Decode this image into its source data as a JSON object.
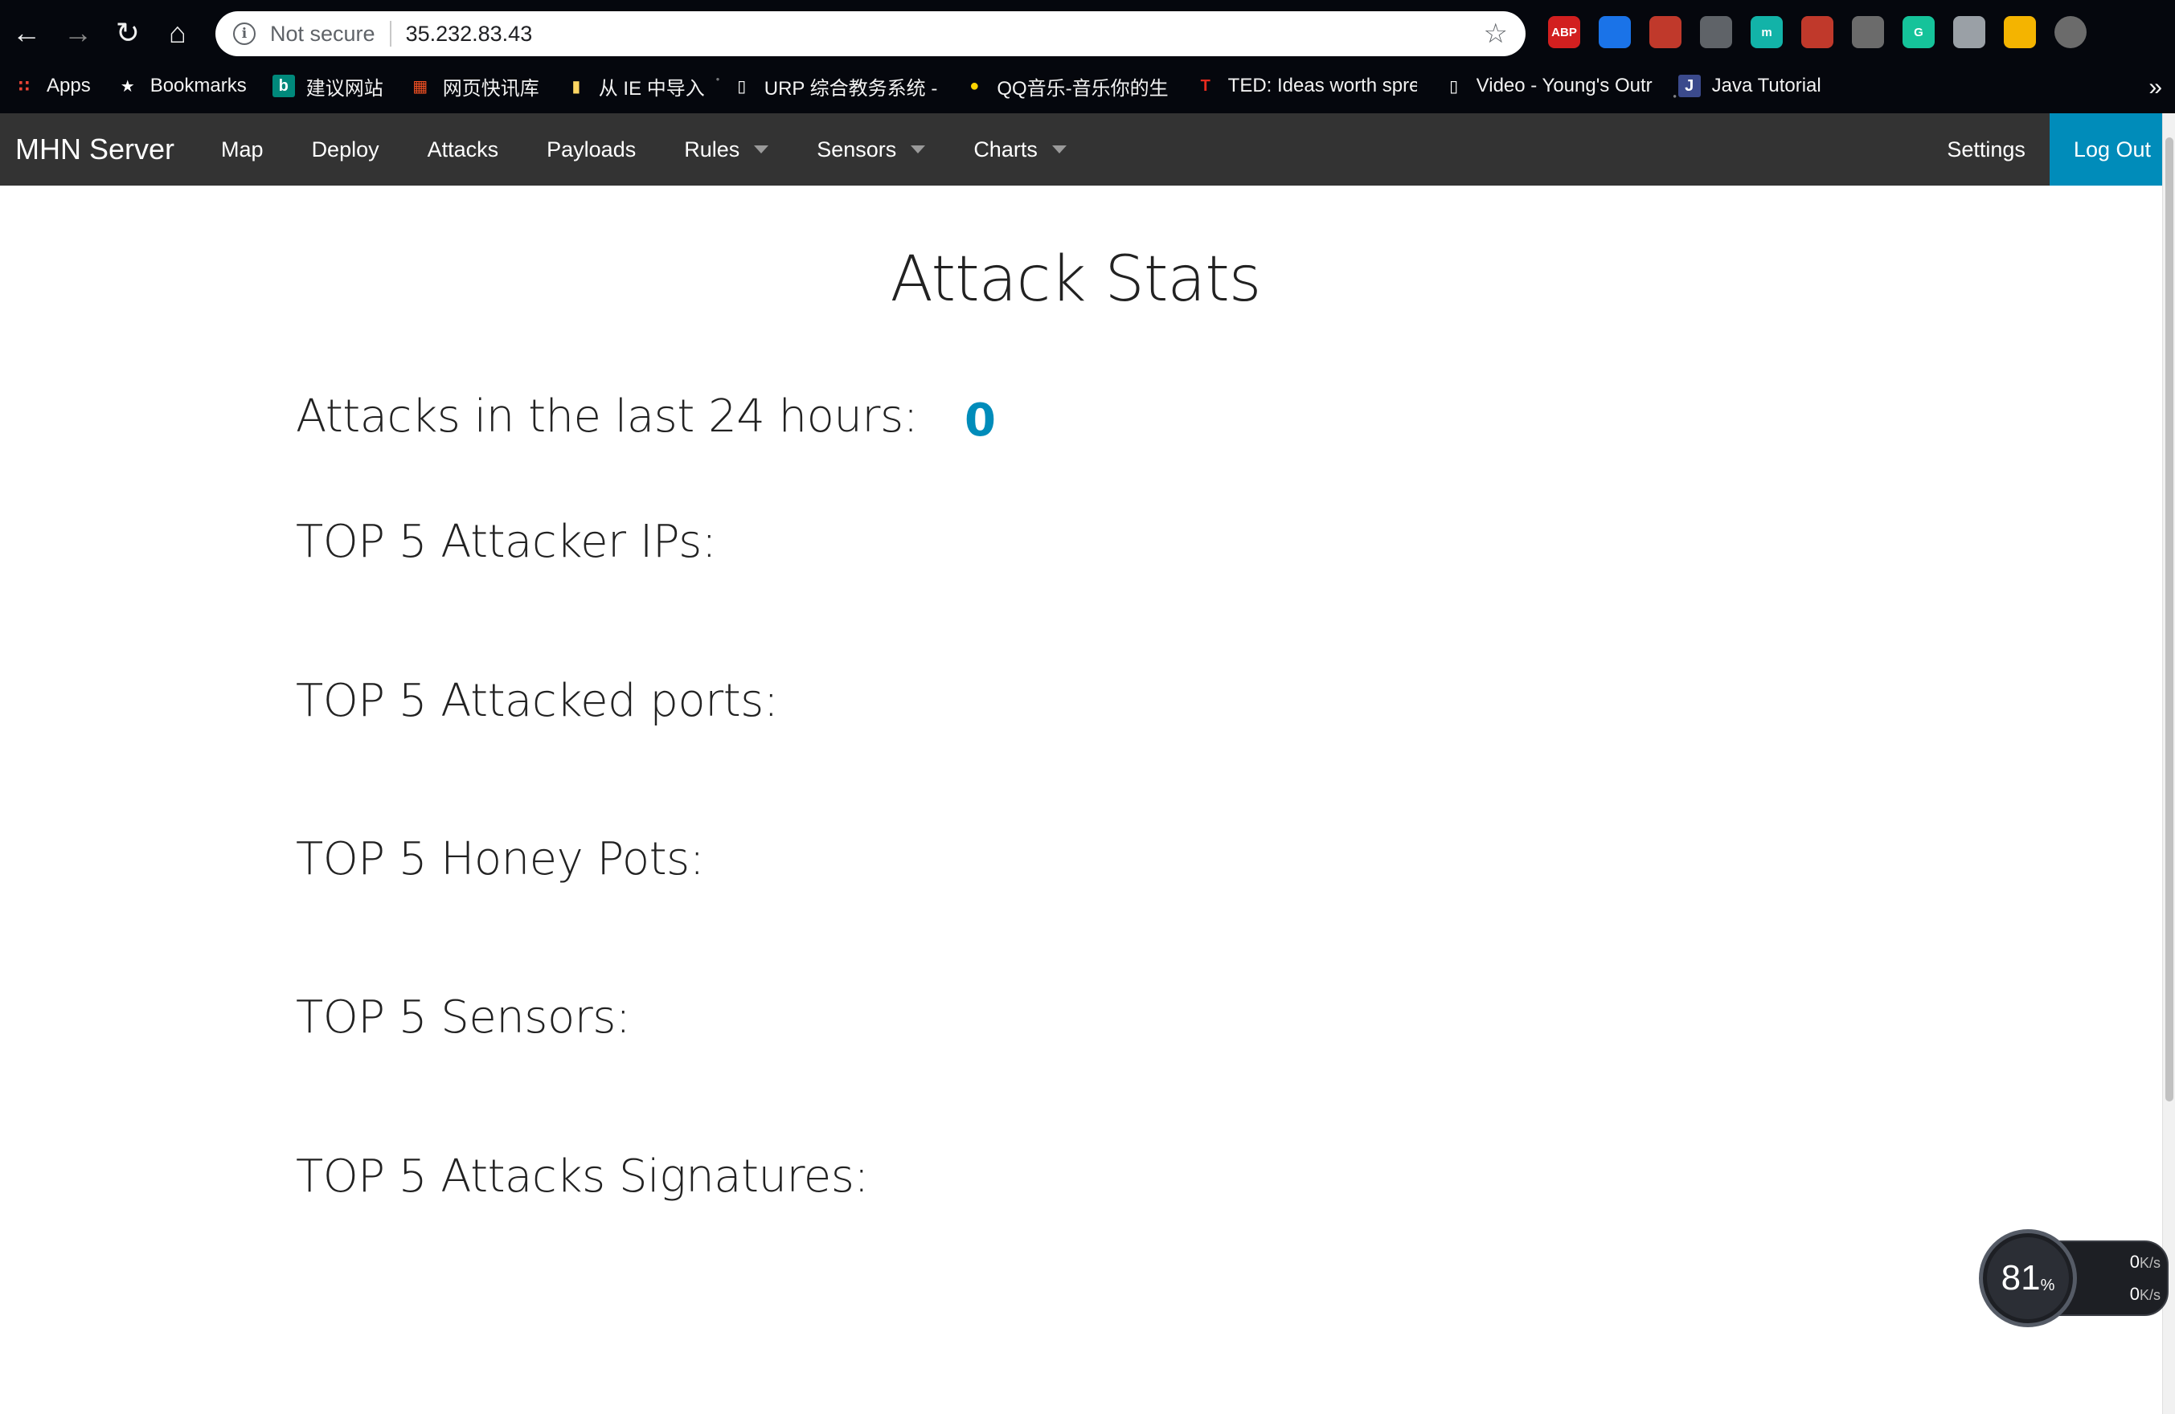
{
  "browser": {
    "omnibox": {
      "security_label": "Not secure",
      "url": "35.232.83.43"
    },
    "bookmarks": [
      {
        "label": "Apps",
        "icon": "apps-grid-icon"
      },
      {
        "label": "Bookmarks",
        "icon": "star-icon"
      },
      {
        "label": "建议网站",
        "icon": "bing-icon"
      },
      {
        "label": "网页快讯库",
        "icon": "microsoft-icon"
      },
      {
        "label": "从 IE 中导入",
        "icon": "folder-icon"
      },
      {
        "label": "URP 综合教务系统 -",
        "icon": "page-icon"
      },
      {
        "label": "QQ音乐-音乐你的生",
        "icon": "qq-music-icon"
      },
      {
        "label": "TED: Ideas worth spre",
        "icon": "ted-icon"
      },
      {
        "label": "Video - Young's Outr",
        "icon": "page-icon"
      },
      {
        "label": "Java Tutorial",
        "icon": "java-icon"
      }
    ],
    "extensions": [
      {
        "name": "adblock-plus-icon",
        "text": "ABP",
        "color": "#d21f1f"
      },
      {
        "name": "translate-extension-icon",
        "text": "",
        "color": "#1a73e8"
      },
      {
        "name": "ublock-icon",
        "text": "",
        "color": "#c0392b"
      },
      {
        "name": "download-extension-icon",
        "text": "",
        "color": "#5f6368"
      },
      {
        "name": "m-extension-icon",
        "text": "m",
        "color": "#12b3a8"
      },
      {
        "name": "book-extension-icon",
        "text": "",
        "color": "#c0392b"
      },
      {
        "name": "pdf-extension-icon",
        "text": "",
        "color": "#6b6b6b"
      },
      {
        "name": "grammarly-icon",
        "text": "G",
        "color": "#15c39a"
      },
      {
        "name": "chat-extension-icon",
        "text": "",
        "color": "#9aa0a6"
      },
      {
        "name": "colorful-extension-icon",
        "text": "",
        "color": "#f4b400"
      },
      {
        "name": "profile-avatar-icon",
        "text": "",
        "color": "#6b6b6b"
      }
    ]
  },
  "navbar": {
    "brand": "MHN Server",
    "items": [
      {
        "label": "Map",
        "dropdown": false
      },
      {
        "label": "Deploy",
        "dropdown": false
      },
      {
        "label": "Attacks",
        "dropdown": false
      },
      {
        "label": "Payloads",
        "dropdown": false
      },
      {
        "label": "Rules",
        "dropdown": true
      },
      {
        "label": "Sensors",
        "dropdown": true
      },
      {
        "label": "Charts",
        "dropdown": true
      }
    ],
    "settings": "Settings",
    "logout": "Log Out",
    "accent_color": "#008cba",
    "bar_color": "#333333"
  },
  "page": {
    "title": "Attack Stats",
    "attacks_24h_label": "Attacks in the last 24 hours:",
    "attacks_24h_value": "0",
    "sections": [
      "TOP 5 Attacker IPs:",
      "TOP 5 Attacked ports:",
      "TOP 5 Honey Pots:",
      "TOP 5 Sensors:",
      "TOP 5 Attacks Signatures:"
    ]
  },
  "speed_widget": {
    "percent": "81",
    "percent_sign": "%",
    "upload": "0",
    "download": "0",
    "unit": "K/s"
  }
}
